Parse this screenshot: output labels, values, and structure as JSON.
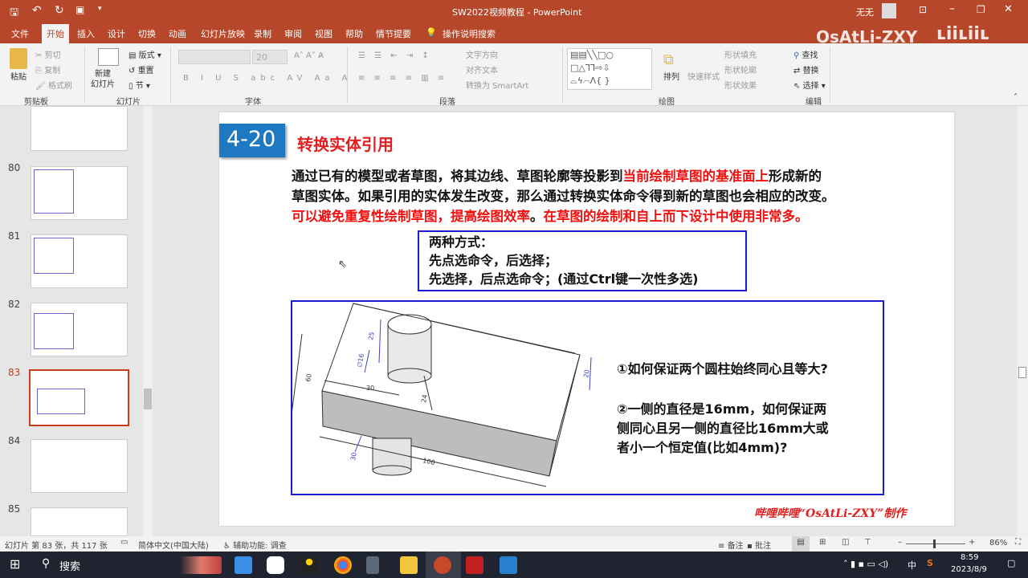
{
  "window": {
    "title": "SW2022视频教程 - PowerPoint",
    "user": "无无",
    "watermark": "OsAtLi-ZXY",
    "brand": "#b7472a"
  },
  "tabs": [
    "文件",
    "开始",
    "插入",
    "设计",
    "切换",
    "动画",
    "幻灯片放映",
    "录制",
    "审阅",
    "视图",
    "帮助",
    "情节提要"
  ],
  "tell_me": "操作说明搜索",
  "ribbon": {
    "clipboard": {
      "label": "剪贴板",
      "paste": "粘贴",
      "cut": "剪切",
      "copy": "复制",
      "format_painter": "格式刷"
    },
    "slides": {
      "label": "幻灯片",
      "new_slide": "新建\n幻灯片",
      "layout": "版式",
      "reset": "重置",
      "section": "节"
    },
    "font": {
      "label": "字体",
      "size": "20"
    },
    "paragraph": {
      "label": "段落",
      "text_direction": "文字方向",
      "align_text": "对齐文本",
      "smartart": "转换为 SmartArt"
    },
    "drawing": {
      "label": "绘图",
      "arrange": "排列",
      "quick_styles": "快速样式",
      "shape_fill": "形状填充",
      "shape_outline": "形状轮廓",
      "shape_effects": "形状效果"
    },
    "editing": {
      "label": "编辑",
      "find": "查找",
      "replace": "替换",
      "select": "选择"
    }
  },
  "thumbnails": [
    {
      "num": ""
    },
    {
      "num": "80"
    },
    {
      "num": "81"
    },
    {
      "num": "82"
    },
    {
      "num": "83",
      "selected": true
    },
    {
      "num": "84"
    },
    {
      "num": "85"
    }
  ],
  "slide": {
    "badge": "4-20",
    "title": "转换实体引用",
    "para1_a": "通过已有的模型或者草图，将其边线、草图轮廓等投影到",
    "para1_red": "当前绘制草图的基准面上",
    "para1_b": "形成新的",
    "para2": "草图实体。如果引用的实体发生改变，那么通过转换实体命令得到新的草图也会相应的改变。",
    "para3_red1": "可以避免重复性绘制草图，提高绘图效率",
    "para3_mid": "。",
    "para3_red2": "在草图的绘制和自上而下设计中使用非常多。",
    "box_lines": [
      "两种方式：",
      "先点选命令，后选择；",
      "先选择，后点选命令；(通过Ctrl键一次性多选)"
    ],
    "dims": {
      "d25": "25",
      "d16": "∅16",
      "d60": "60",
      "d30a": "30",
      "d24": "24",
      "d20": "20",
      "d30b": "30",
      "d100": "100"
    },
    "q1": "①如何保证两个圆柱始终同心且等大?",
    "q2": [
      "②一侧的直径是16mm，如何保证两",
      "侧同心且另一侧的直径比16mm大或",
      "者小一个恒定值(比如4mm)?"
    ],
    "credit": "哔哩哔哩“OsAtLi-ZXY”制作"
  },
  "status": {
    "slide_info": "幻灯片 第 83 张，共 117 张",
    "language": "简体中文(中国大陆)",
    "accessibility": "辅助功能: 调查",
    "notes": "备注",
    "comments": "批注",
    "zoom": "86%",
    "zoom_value": 86
  },
  "taskbar": {
    "search": "搜索",
    "time": "8:59",
    "date": "2023/8/9",
    "ime": "中"
  }
}
